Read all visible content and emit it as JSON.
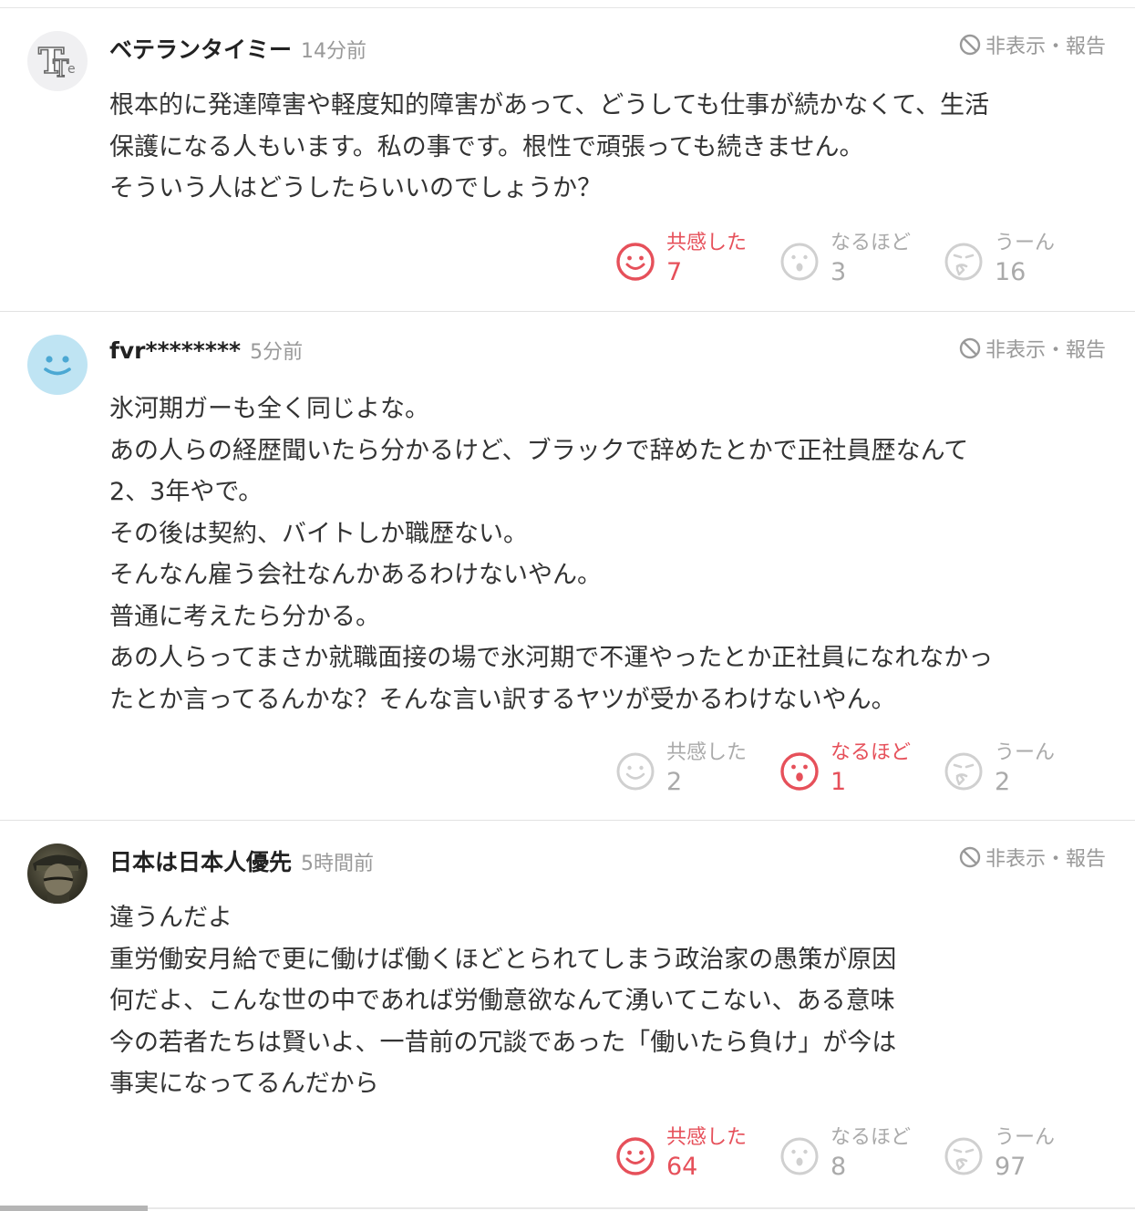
{
  "comments": [
    {
      "username": "ベテランタイミー",
      "time": "14分前",
      "report": "非表示・報告",
      "avatar": "letter-t-avatar",
      "lines": [
        "根本的に発達障害や軽度知的障害があって、どうしても仕事が続かなくて、生活",
        "保護になる人もいます。私の事です。根性で頑張っても続きません。",
        "そういう人はどうしたらいいのでしょうか？"
      ],
      "reactions": [
        {
          "label": "共感した",
          "count": "7",
          "icon": "smile-face-icon",
          "active": true
        },
        {
          "label": "なるほど",
          "count": "3",
          "icon": "surprised-face-icon",
          "active": false
        },
        {
          "label": "うーん",
          "count": "16",
          "icon": "thinking-face-icon",
          "active": false
        }
      ]
    },
    {
      "username": "fvr********",
      "time": "5分前",
      "report": "非表示・報告",
      "avatar": "default-smile-avatar",
      "lines": [
        "氷河期ガーも全く同じよな。",
        "あの人らの経歴聞いたら分かるけど、ブラックで辞めたとかで正社員歴なんて",
        "2、3年やで。",
        "その後は契約、バイトしか職歴ない。",
        "そんなん雇う会社なんかあるわけないやん。",
        "普通に考えたら分かる。",
        "あの人らってまさか就職面接の場で氷河期で不運やったとか正社員になれなかっ",
        "たとか言ってるんかな？そんな言い訳するヤツが受かるわけないやん。"
      ],
      "reactions": [
        {
          "label": "共感した",
          "count": "2",
          "icon": "smile-face-icon",
          "active": false
        },
        {
          "label": "なるほど",
          "count": "1",
          "icon": "surprised-face-icon",
          "active": true
        },
        {
          "label": "うーん",
          "count": "2",
          "icon": "thinking-face-icon",
          "active": false
        }
      ]
    },
    {
      "username": "日本は日本人優先",
      "time": "5時間前",
      "report": "非表示・報告",
      "avatar": "photo-avatar",
      "lines": [
        "違うんだよ",
        "重労働安月給で更に働けば働くほどとられてしまう政治家の愚策が原因",
        "何だよ、こんな世の中であれば労働意欲なんて湧いてこない、ある意味",
        "今の若者たちは賢いよ、一昔前の冗談であった「働いたら負け」が今は",
        "事実になってるんだから"
      ],
      "reactions": [
        {
          "label": "共感した",
          "count": "64",
          "icon": "smile-face-icon",
          "active": true
        },
        {
          "label": "なるほど",
          "count": "8",
          "icon": "surprised-face-icon",
          "active": false
        },
        {
          "label": "うーん",
          "count": "97",
          "icon": "thinking-face-icon",
          "active": false
        }
      ]
    }
  ],
  "colors": {
    "active": "#e6505a",
    "inactive": "#bbbbbb",
    "muted": "#999999"
  }
}
